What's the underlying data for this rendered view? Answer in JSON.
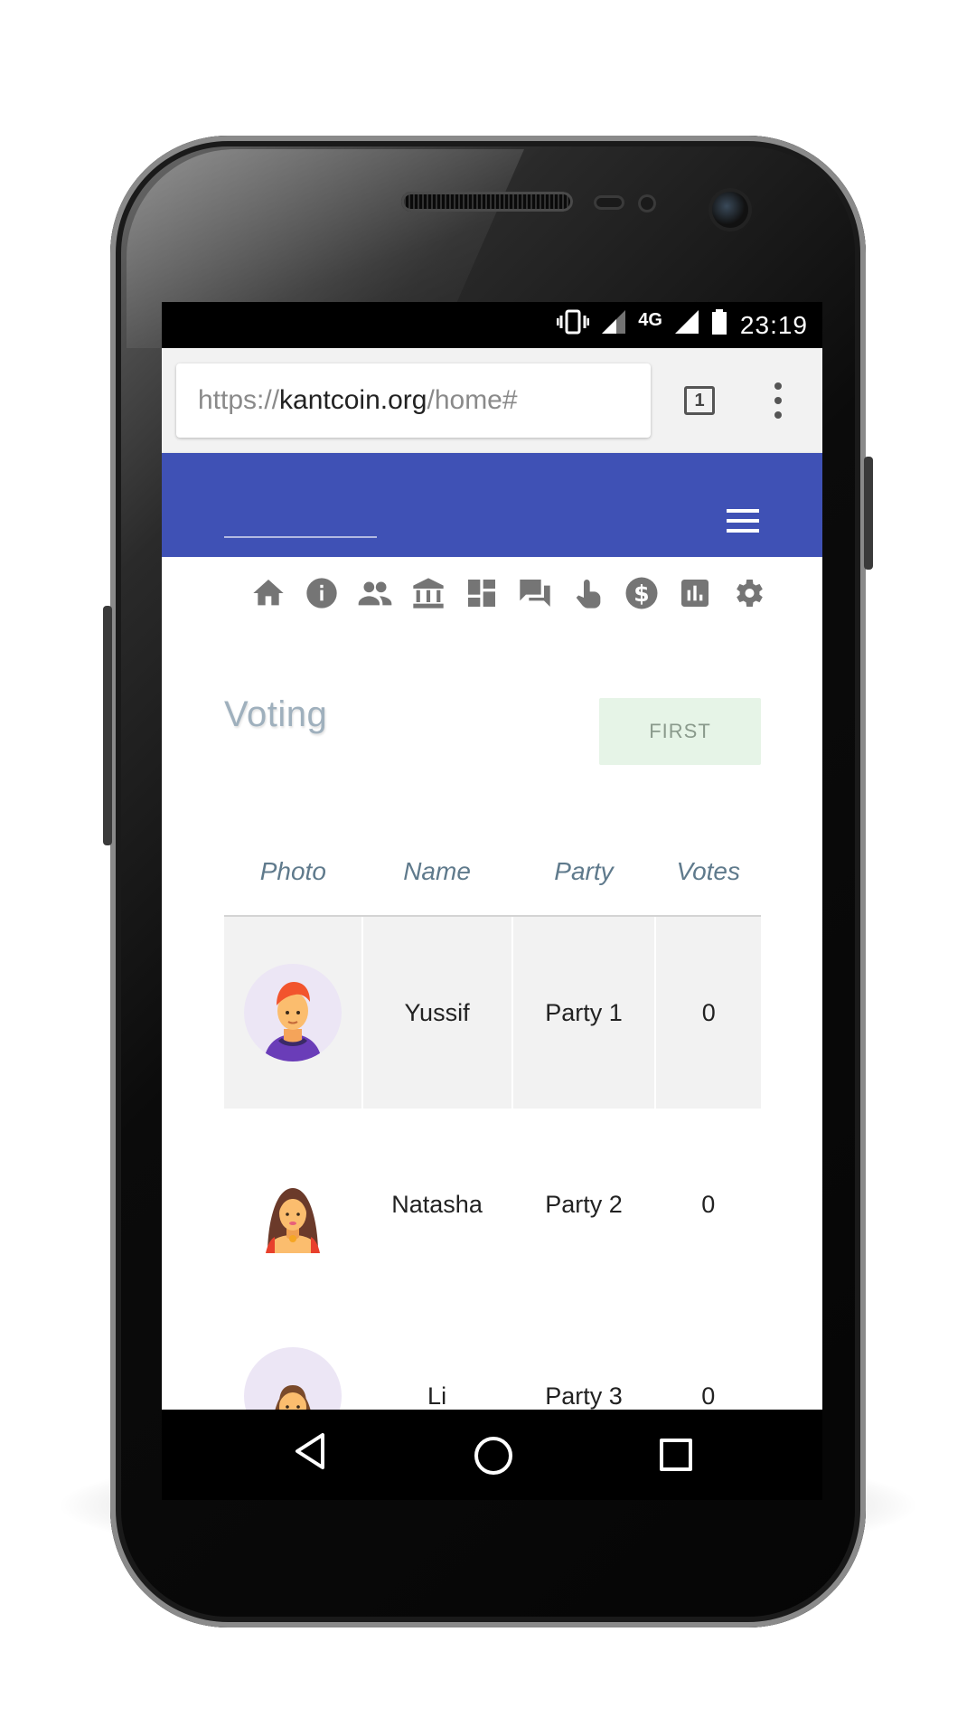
{
  "statusbar": {
    "network": "4G",
    "time": "23:19"
  },
  "browser": {
    "url_scheme": "https://",
    "url_host": "kantcoin.org",
    "url_path": "/home#",
    "tab_count": "1"
  },
  "nav_icons": [
    "home-icon",
    "info-icon",
    "people-icon",
    "bank-icon",
    "dashboard-icon",
    "forum-icon",
    "touch-icon",
    "dollar-icon",
    "chart-icon",
    "gear-icon"
  ],
  "page": {
    "title": "Voting",
    "first_button": "FIRST"
  },
  "table": {
    "headers": [
      "Photo",
      "Name",
      "Party",
      "Votes"
    ],
    "rows": [
      {
        "name": "Yussif",
        "party": "Party 1",
        "votes": "0"
      },
      {
        "name": "Natasha",
        "party": "Party 2",
        "votes": "0"
      },
      {
        "name": "Li",
        "party": "Party 3",
        "votes": "0"
      }
    ]
  },
  "colors": {
    "appbar": "#3f51b5",
    "first_button_bg": "#e6f4e7",
    "header_text": "#5f7a8c"
  }
}
